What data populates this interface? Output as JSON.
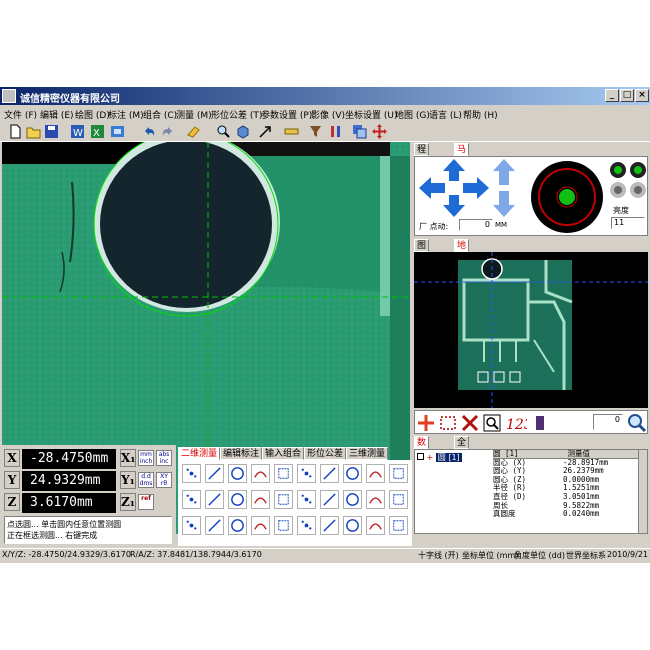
{
  "window": {
    "title": "诚信精密仪器有限公司",
    "controls": {
      "minimize": "_",
      "maximize": "□",
      "close": "×"
    }
  },
  "menu": [
    "文件 (F)",
    "编辑 (E)",
    "绘图 (D)",
    "标注 (M)",
    "组合 (C)",
    "测量 (M)",
    "形位公差 (T)",
    "参数设置 (P)",
    "影像 (V)",
    "坐标设置 (U)",
    "地图 (G)",
    "语言 (L)",
    "帮助 (H)"
  ],
  "toolbar_icons": [
    "new-file-icon",
    "open-folder-icon",
    "save-icon",
    "word-icon",
    "excel-icon",
    "export-icon",
    "undo-icon",
    "redo-icon",
    "eraser-icon",
    "zoom-icon",
    "cube-icon",
    "arrow-select-icon",
    "ruler-icon",
    "filter-icon",
    "bars-icon",
    "window-icon",
    "move-icon"
  ],
  "camera": {
    "accent": "#2a9b72"
  },
  "right_panel": {
    "top_tabs": [
      "程序窗口",
      "马达窗口"
    ],
    "top_active": 1,
    "point_move_label": "厂 点动:",
    "point_move_value": "0",
    "point_move_unit": "MM",
    "brightness_label": "亮度",
    "brightness_value": "11",
    "mid_tabs": [
      "图形窗口",
      "地图窗口"
    ],
    "mid_active": 1,
    "counter_value": "0",
    "bottom_tabs": [
      "数据窗口",
      "全览窗口"
    ],
    "bottom_active": 0,
    "tree_item": "圆 [1]",
    "table_header": [
      "圆 [1]",
      "测量值"
    ],
    "table_rows": [
      [
        "圆心 (X)",
        "-28.8917mm"
      ],
      [
        "圆心 (Y)",
        "26.2379mm"
      ],
      [
        "圆心 (Z)",
        "0.0000mm"
      ],
      [
        "半径 (R)",
        "1.5251mm"
      ],
      [
        "直径 (D)",
        "3.0501mm"
      ],
      [
        "周长",
        "9.5822mm"
      ],
      [
        "真圆度",
        "0.0240mm"
      ]
    ]
  },
  "dro": {
    "x": "-28.4750mm",
    "y": "24.9329mm",
    "z": "3.6170mm",
    "labels": [
      "X",
      "Y",
      "Z"
    ],
    "unit_buttons": [
      "mm inch",
      "abs inc",
      "d.d dms",
      "XY rθ",
      "ref"
    ],
    "subscript_labels": [
      "X₁",
      "Y₁",
      "Z₁"
    ]
  },
  "prompt": {
    "line1": "点选圆... 单击圆内任意位置测圆",
    "line2": "正在框选测圆... 右键完成"
  },
  "measure_tabs": [
    "二维测量",
    "编辑标注",
    "输入组合",
    "形位公差",
    "三维测量"
  ],
  "measure_active": 0,
  "status": {
    "xyz": "X/Y/Z:  -28.4750/24.9329/3.6170",
    "raz": "R/A/Z:  37.8481/138.7944/3.6170",
    "crosshair": "十字线 (开)",
    "coord_unit": "坐标单位 (mm)",
    "angle_unit": "角度单位 (dd)",
    "world": "世界坐标系",
    "date": "2010/9/21"
  }
}
